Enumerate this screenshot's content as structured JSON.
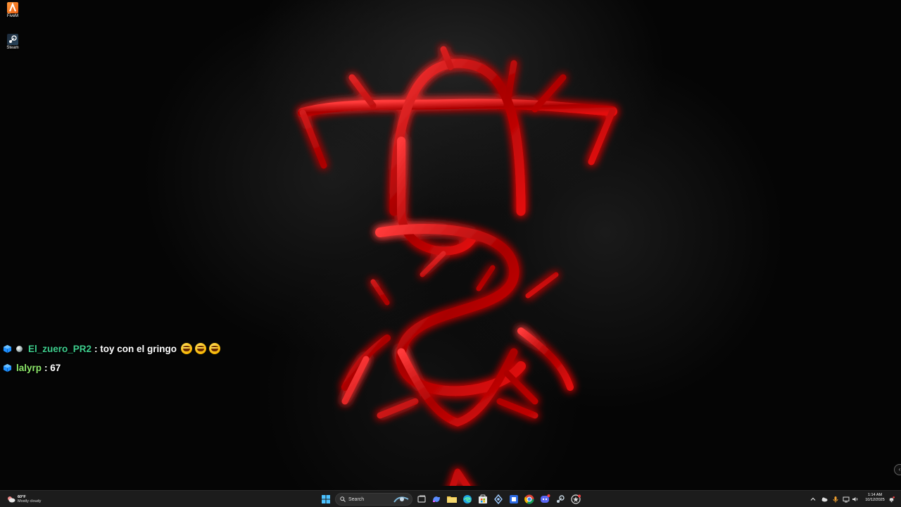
{
  "desktop": {
    "icons": [
      {
        "label": "FiveM",
        "icon": "fivem-icon"
      },
      {
        "label": "Steam",
        "icon": "steam-icon"
      }
    ],
    "wallpaper": {
      "logo_color": "#c40000",
      "glow_color": "#ff1a1a"
    }
  },
  "chat": {
    "messages": [
      {
        "user": "El_zuero_PR2",
        "text": ": toy con el gringo",
        "user_color": "#3ecf8e",
        "emojis": [
          "rolling-laughing-emoji",
          "rolling-laughing-emoji",
          "rolling-laughing-emoji"
        ]
      },
      {
        "user": "lalyrp",
        "text": ": 67",
        "user_color": "#8de86a"
      }
    ]
  },
  "taskbar": {
    "weather": {
      "temp": "60°F",
      "desc": "Mostly cloudy"
    },
    "search_label": "Search",
    "pinned_apps": [
      "task-view-icon",
      "copilot-icon",
      "file-explorer-icon",
      "edge-icon",
      "store-icon",
      "vpn-icon",
      "app-icon",
      "chrome-icon",
      "discord-icon",
      "steam-icon",
      "rockstar-icon"
    ],
    "clock": {
      "time": "1:14 AM",
      "date": "10/12/2025"
    }
  }
}
